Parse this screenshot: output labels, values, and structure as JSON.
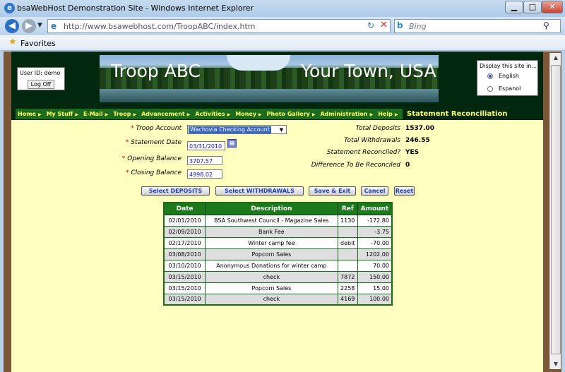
{
  "window": {
    "title": "bsaWebHost Demonstration Site - Windows Internet Explorer"
  },
  "browser": {
    "url": "http://www.bsawebhost.com/TroopABC/index.htm",
    "search_placeholder": "Bing",
    "favorites_label": "Favorites"
  },
  "header": {
    "user_id_label": "User ID:",
    "user_id": "demo",
    "log_off": "Log Off",
    "banner_left": "Troop ABC",
    "banner_right": "Your Town, USA",
    "lang_title": "Display this site in...",
    "lang_options": [
      "English",
      "Espanol"
    ],
    "lang_selected": "English"
  },
  "menu": {
    "items": [
      "Home",
      "My Stuff",
      "E-Mail",
      "Troop",
      "Advancement",
      "Activities",
      "Money",
      "Photo Gallery",
      "Administration",
      "Help"
    ],
    "page_title": "Statement Reconciliation"
  },
  "form": {
    "troop_account_label": "Troop Account",
    "troop_account_value": "Wachovia Checking Account",
    "statement_date_label": "Statement Date",
    "statement_date_value": "03/31/2010",
    "opening_balance_label": "Opening Balance",
    "opening_balance_value": "3707.57",
    "closing_balance_label": "Closing Balance",
    "closing_balance_value": "4998.02",
    "required_mark": "*"
  },
  "summary": {
    "total_deposits_label": "Total Deposits",
    "total_deposits": "1537.00",
    "total_withdrawals_label": "Total Withdrawals",
    "total_withdrawals": "246.55",
    "reconciled_label": "Statement Reconciled?",
    "reconciled": "YES",
    "difference_label": "Difference To Be Reconciled",
    "difference": "0"
  },
  "actions": {
    "select_deposits": "Select DEPOSITS",
    "select_withdrawals": "Select WITHDRAWALS",
    "save_exit": "Save & Exit",
    "cancel": "Cancel",
    "reset": "Reset"
  },
  "table": {
    "headers": [
      "Date",
      "Description",
      "Ref",
      "Amount"
    ],
    "rows": [
      {
        "date": "02/01/2010",
        "description": "BSA Southwest Council - Magazine Sales",
        "ref": "1130",
        "amount": "-172.80"
      },
      {
        "date": "02/09/2010",
        "description": "Bank Fee",
        "ref": "",
        "amount": "-3.75"
      },
      {
        "date": "02/17/2010",
        "description": "Winter camp fee",
        "ref": "debit",
        "amount": "-70.00"
      },
      {
        "date": "03/08/2010",
        "description": "Popcorn Sales",
        "ref": "",
        "amount": "1202.00"
      },
      {
        "date": "03/10/2010",
        "description": "Anonymous Donations for winter camp",
        "ref": "",
        "amount": "70.00"
      },
      {
        "date": "03/15/2010",
        "description": "check",
        "ref": "7872",
        "amount": "150.00"
      },
      {
        "date": "03/15/2010",
        "description": "Popcorn Sales",
        "ref": "2258",
        "amount": "15.00"
      },
      {
        "date": "03/15/2010",
        "description": "check",
        "ref": "4169",
        "amount": "100.00"
      }
    ]
  }
}
